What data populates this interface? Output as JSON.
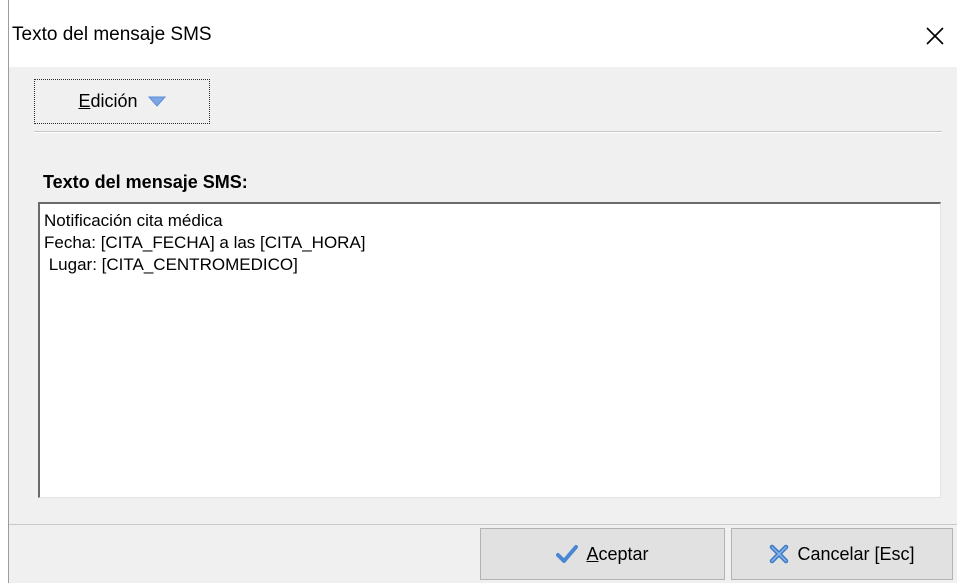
{
  "window": {
    "title": "Texto del mensaje SMS"
  },
  "menu": {
    "edit_label_underlined": "E",
    "edit_label_rest": "dición",
    "edit_dropdown_icon": "chevron-down-icon"
  },
  "form": {
    "label": "Texto del mensaje SMS:",
    "message_text": "Notificación cita médica\nFecha: [CITA_FECHA] a las [CITA_HORA]\n Lugar: [CITA_CENTROMEDICO]"
  },
  "buttons": {
    "accept_underlined": "A",
    "accept_rest": "ceptar",
    "accept_icon": "check-icon",
    "cancel_label": "Cancelar [Esc]",
    "cancel_icon": "x-icon"
  },
  "colors": {
    "accent_blue": "#5b8fd8",
    "check_blue": "#4a86d4",
    "cross_blue": "#3d7ac9"
  }
}
